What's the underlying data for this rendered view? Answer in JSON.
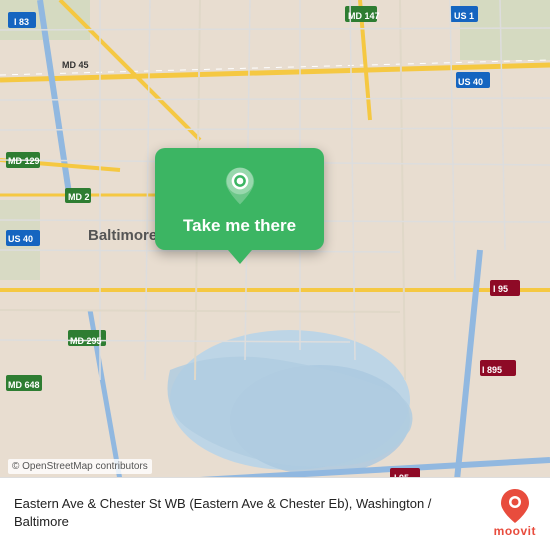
{
  "map": {
    "background_color": "#e8e0d8",
    "center": "Baltimore, MD"
  },
  "popup": {
    "button_label": "Take me there",
    "background_color": "#3cb563"
  },
  "attribution": {
    "text": "© OpenStreetMap contributors"
  },
  "info_bar": {
    "location_text": "Eastern Ave & Chester St WB (Eastern Ave & Chester Eb), Washington / Baltimore",
    "moovit_label": "moovit"
  }
}
